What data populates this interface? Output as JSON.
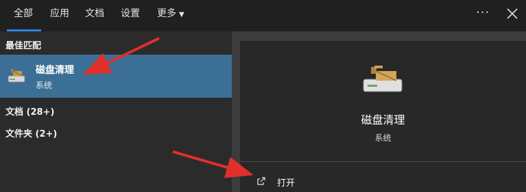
{
  "tabs": [
    {
      "label": "全部",
      "active": true
    },
    {
      "label": "应用"
    },
    {
      "label": "文档"
    },
    {
      "label": "设置"
    },
    {
      "label": "更多"
    }
  ],
  "toolbar": {
    "more_icon": "ellipsis-icon",
    "close_icon": "close-icon"
  },
  "results": {
    "best_match_heading": "最佳匹配",
    "best_match": {
      "title": "磁盘清理",
      "subtitle": "系统",
      "icon": "disk-cleanup-icon"
    },
    "groups": [
      {
        "label": "文档 (28+)"
      },
      {
        "label": "文件夹 (2+)"
      }
    ]
  },
  "detail": {
    "title": "磁盘清理",
    "subtitle": "系统",
    "action_open": "打开",
    "action_icon": "open-external-icon"
  },
  "colors": {
    "accent": "#2f86d7",
    "selected": "#3c6f96",
    "arrow": "#e0302c"
  }
}
